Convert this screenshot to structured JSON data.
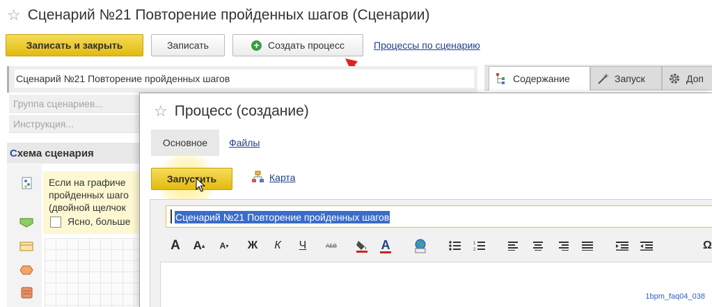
{
  "main_window": {
    "title": "Сценарий №21 Повторение пройденных шагов (Сценарии)",
    "toolbar": {
      "save_close_label": "Записать и закрыть",
      "save_label": "Записать",
      "create_process_label": "Создать процесс",
      "processes_link": "Процессы по сценарию"
    },
    "name_field_value": "Сценарий №21 Повторение пройденных шагов",
    "group_placeholder": "Группа сценариев...",
    "instruction_placeholder": "Инструкция...",
    "schema_header_first_letter": "С",
    "schema_header_rest": "хема сценария",
    "hint_lines": [
      "Если на графиче",
      "пройденных шаго",
      "(двойной щелчок"
    ],
    "hint_checkbox_label": "Ясно, больше",
    "tabs": [
      {
        "label": "Содержание",
        "icon": "tree-icon",
        "active": true
      },
      {
        "label": "Запуск",
        "icon": "wand-icon",
        "active": false
      },
      {
        "label": "Доп",
        "icon": "gear-icon",
        "active": false
      }
    ]
  },
  "modal": {
    "title": "Процесс (создание)",
    "tabs": {
      "main": "Основное",
      "files": "Файлы"
    },
    "run_label": "Запустить",
    "map_label": "Карта",
    "name_value": "Сценарий №21 Повторение пройденных шагов",
    "format_toolbar": {
      "bold_label": "Ж",
      "italic_label": "К",
      "underline_label": "Ч",
      "strike_label": "АБВ"
    }
  },
  "watermark": "1bpm_faq04_038",
  "colors": {
    "primary_button": "#e2ba0f",
    "link": "#1e3f8a",
    "annotation_arrow": "#e32020",
    "selection": "#3a6cc9",
    "hint_background": "#fdf8d2"
  }
}
